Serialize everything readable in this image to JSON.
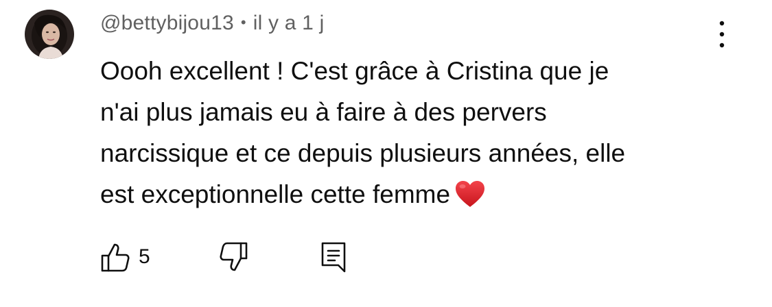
{
  "comment": {
    "author": "@bettybijou13",
    "separator": "•",
    "time": "il y a 1 j",
    "text_lines": [
      "Oooh excellent ! C'est grâce à Cristina que je",
      "n'ai plus jamais eu à faire à des pervers",
      "narcissique et ce depuis plusieurs années, elle",
      "est exceptionnelle cette femme"
    ],
    "emoji": "red-heart-emoji"
  },
  "actions": {
    "like_count": "5",
    "like_icon": "thumbs-up-icon",
    "dislike_icon": "thumbs-down-icon",
    "reply_icon": "reply-comment-icon",
    "more_icon": "more-vertical-icon"
  },
  "colors": {
    "text": "#0f0f0f",
    "meta": "#606060",
    "heart": "#e0242c"
  }
}
